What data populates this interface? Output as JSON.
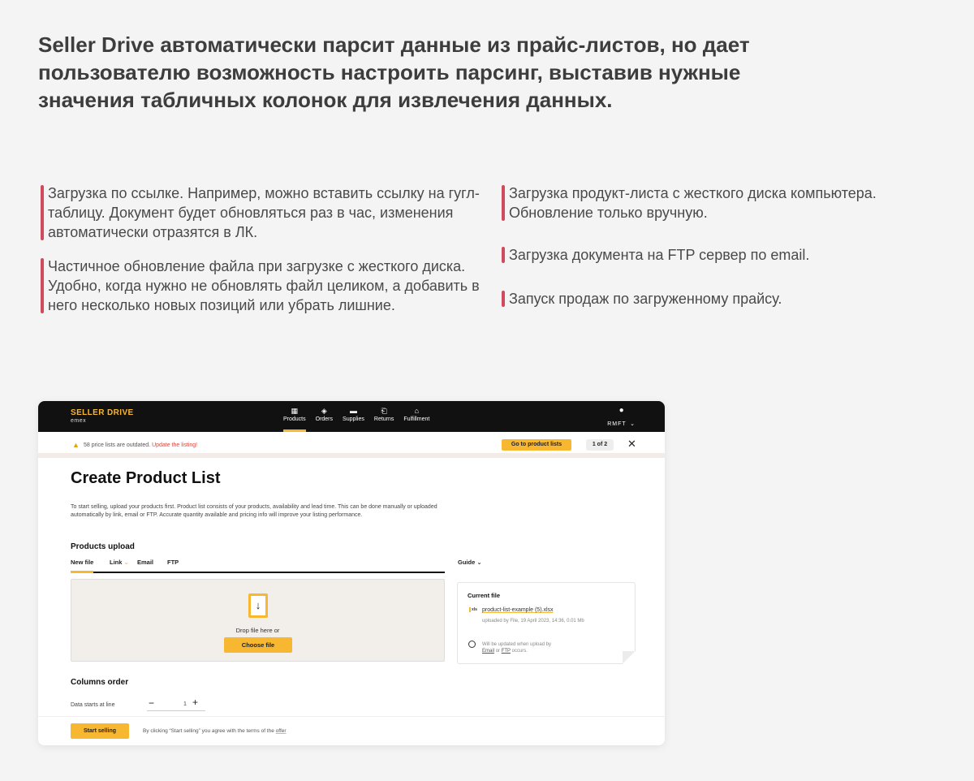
{
  "headline": "Seller Drive автоматически парсит данные из прайс-листов, но дает пользователю возможность настроить парсинг, выставив нужные значения табличных колонок для извлечения данных.",
  "bullets_left": [
    "Загрузка по ссылке. Например, можно вставить ссылку на гугл-таблицу. Документ будет обновляться раз в час, изменения автоматически отразятся в ЛК.",
    "Частичное обновление файла при загрузке с жесткого диска. Удобно, когда нужно не обновлять файл целиком, а добавить в него несколько новых позиций или убрать лишние."
  ],
  "bullets_right": [
    "Загрузка продукт-листа с жесткого диска компьютера. Обновление только вручную.",
    "Загрузка документа на FTP сервер по email.",
    "Запуск продаж по загруженному прайсу."
  ],
  "colors": {
    "accent": "#f7b731",
    "bullet_marker": "#cf4b5e",
    "topbar": "#111111",
    "alert_link": "#d9463c"
  },
  "app": {
    "brand": {
      "name": "SELLER DRIVE",
      "sub": "emex"
    },
    "nav": [
      {
        "label": "Products",
        "icon": "boxes-icon",
        "glyph": "▦",
        "active": true
      },
      {
        "label": "Orders",
        "icon": "package-icon",
        "glyph": "◈",
        "active": false
      },
      {
        "label": "Supplies",
        "icon": "truck-icon",
        "glyph": "▬",
        "active": false
      },
      {
        "label": "Returns",
        "icon": "return-icon",
        "glyph": "⎗",
        "active": false
      },
      {
        "label": "Fulfillment",
        "icon": "warehouse-icon",
        "glyph": "⌂",
        "active": false
      }
    ],
    "account": {
      "label": "RMFT",
      "icon": "user-icon"
    },
    "alert": {
      "text": "58 price lists are outdated.",
      "link": "Update the listing!",
      "button": "Go to product lists",
      "pager": "1 of 2"
    },
    "title": "Create Product List",
    "intro": "To start selling, upload your products first. Product list consists of your products, availability and lead time. This can be done manually or uploaded automatically by link, email or FTP. Accurate quantity available and pricing info will improve your listing performance.",
    "upload_section": "Products upload",
    "tabs": [
      {
        "label": "New file",
        "active": true
      },
      {
        "label": "Link",
        "active": false
      },
      {
        "label": "Email",
        "active": false
      },
      {
        "label": "FTP",
        "active": false
      }
    ],
    "guide": "Guide",
    "dropzone": {
      "text": "Drop file here or",
      "button": "Choose file"
    },
    "current_file": {
      "title": "Current file",
      "file_icon": "xls",
      "name": "product-list-example (5).xlsx",
      "meta": "uploaded by File, 19 April 2023, 14:36, 0.01 Mb",
      "update_text": "Will be updated when upload by",
      "update_link1": "Email",
      "update_mid": "or",
      "update_link2": "FTP",
      "update_end": "occurs."
    },
    "columns_order": "Columns order",
    "stepper": {
      "label": "Data starts at line",
      "value": "1"
    },
    "footer": {
      "button": "Start selling",
      "terms": "By clicking “Start selling” you agree with the terms of the",
      "terms_link": "offer"
    }
  }
}
